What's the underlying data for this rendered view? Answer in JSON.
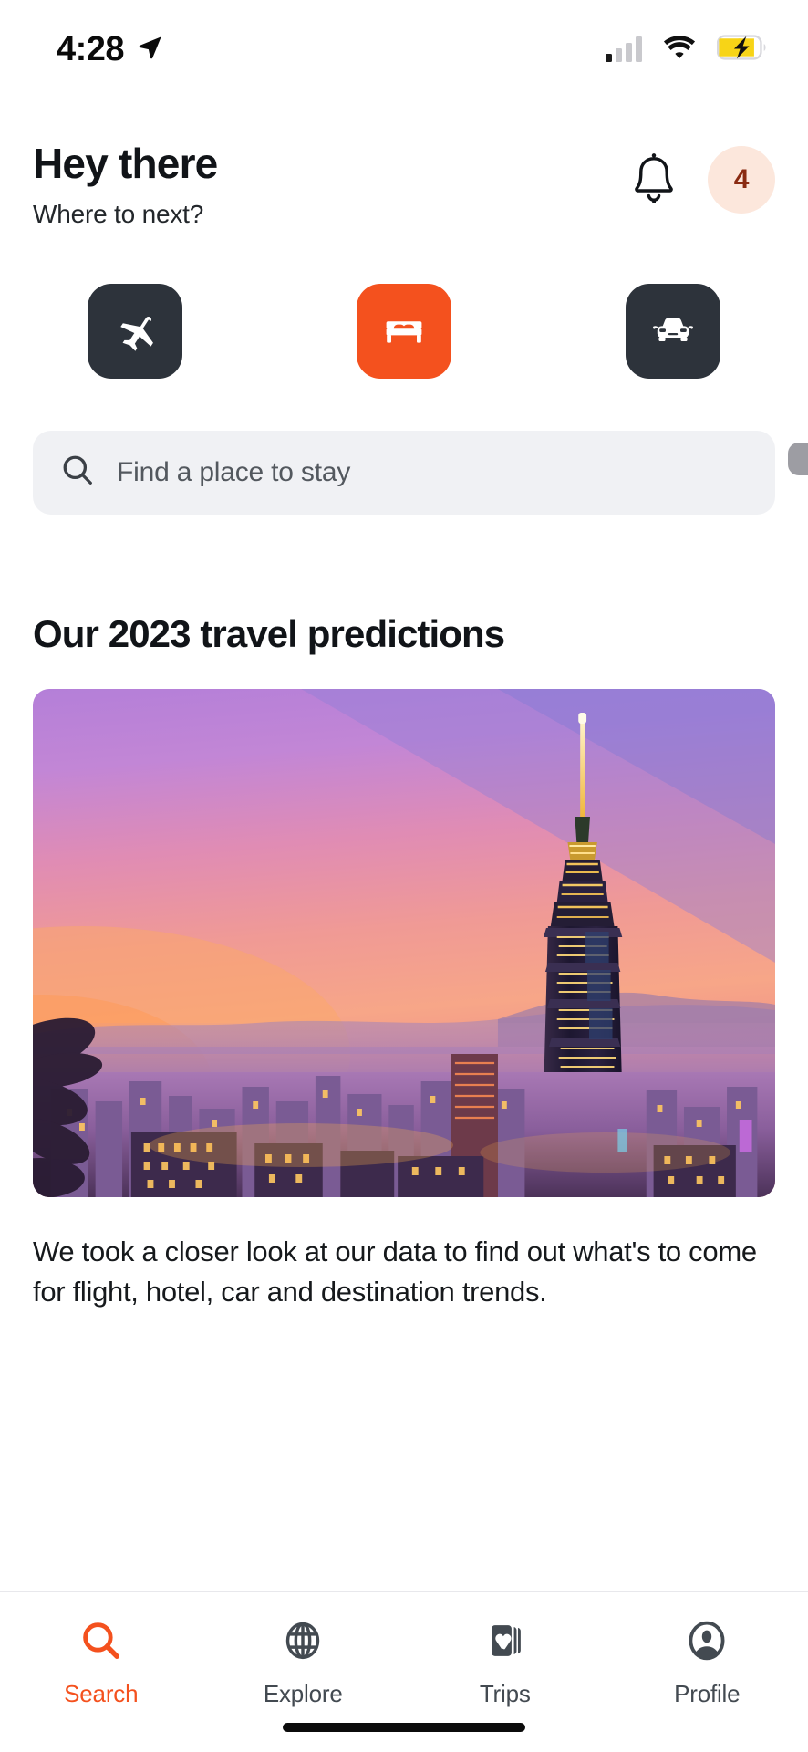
{
  "status_bar": {
    "time": "4:28",
    "location_icon": "location-arrow-icon",
    "signal_icon": "cellular-signal-icon",
    "signal_bars_filled": 1,
    "signal_bars_total": 4,
    "wifi_icon": "wifi-icon",
    "battery_icon": "battery-charging-icon",
    "battery_color": "#f7d417"
  },
  "header": {
    "title": "Hey there",
    "subtitle": "Where to next?",
    "bell_icon": "notification-bell-icon",
    "badge_count": "4",
    "badge_bg": "#fce7dc",
    "badge_text_color": "#8a2b12"
  },
  "categories": [
    {
      "id": "flights",
      "icon": "airplane-icon",
      "label": "Flights",
      "selected": false,
      "bg": "#2d333b"
    },
    {
      "id": "hotels",
      "icon": "bed-icon",
      "label": "Hotels",
      "selected": true,
      "bg": "#f4511e"
    },
    {
      "id": "cars",
      "icon": "car-icon",
      "label": "Cars",
      "selected": false,
      "bg": "#2d333b"
    }
  ],
  "search": {
    "icon": "search-icon",
    "placeholder": "Find a place to stay",
    "value": ""
  },
  "section": {
    "title": "Our 2023 travel predictions",
    "image_alt": "taipei-101-skyline-at-sunset",
    "description": "We took a closer look at our data to find out what's to come for flight, hotel, car and destination trends."
  },
  "bottom_nav": {
    "active_color": "#f4511e",
    "inactive_color": "#434a51",
    "items": [
      {
        "id": "search",
        "label": "Search",
        "icon": "search-icon",
        "active": true
      },
      {
        "id": "explore",
        "label": "Explore",
        "icon": "globe-icon",
        "active": false
      },
      {
        "id": "trips",
        "label": "Trips",
        "icon": "cards-heart-icon",
        "active": false
      },
      {
        "id": "profile",
        "label": "Profile",
        "icon": "person-circle-icon",
        "active": false
      }
    ]
  },
  "theme": {
    "accent": "#f4511e",
    "dark": "#2d333b",
    "search_bg": "#f0f1f4",
    "page_bg": "#ffffff"
  }
}
